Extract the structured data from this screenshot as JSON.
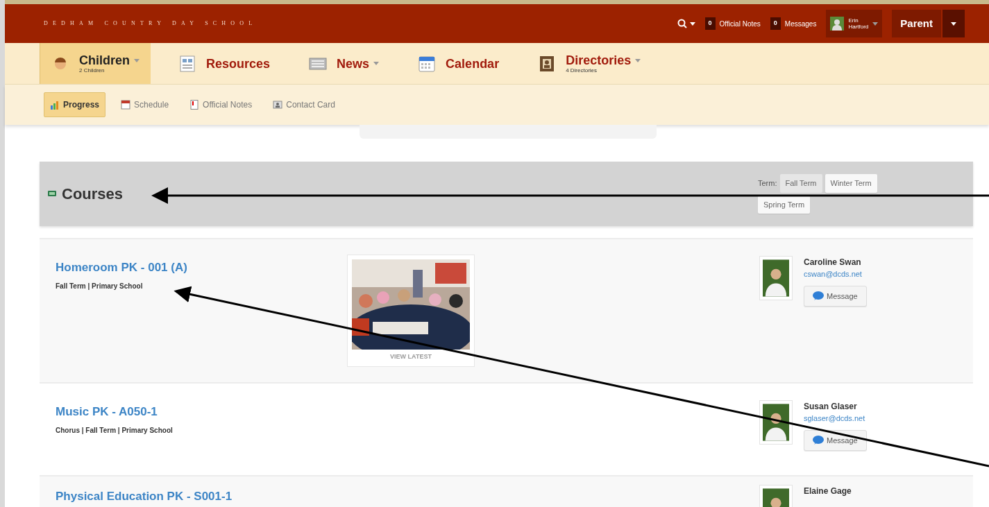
{
  "header": {
    "school_name": "DEDHAM COUNTRY DAY SCHOOL",
    "official_notes": {
      "count": "0",
      "label": "Official Notes"
    },
    "messages": {
      "count": "0",
      "label": "Messages"
    },
    "user": {
      "first": "Erin",
      "last": "Hartford"
    },
    "role": "Parent"
  },
  "nav": [
    {
      "label": "Children",
      "sub": "2 Children",
      "selected": true,
      "dropdown": true
    },
    {
      "label": "Resources",
      "selected": false,
      "dropdown": false
    },
    {
      "label": "News",
      "selected": false,
      "dropdown": true
    },
    {
      "label": "Calendar",
      "selected": false,
      "dropdown": false
    },
    {
      "label": "Directories",
      "sub": "4 Directories",
      "selected": false,
      "dropdown": true
    }
  ],
  "subnav": [
    {
      "label": "Progress",
      "selected": true
    },
    {
      "label": "Schedule",
      "selected": false
    },
    {
      "label": "Official Notes",
      "selected": false
    },
    {
      "label": "Contact Card",
      "selected": false
    }
  ],
  "courses": {
    "title": "Courses",
    "term_label": "Term:",
    "terms": [
      {
        "label": "Fall Term",
        "selected": true
      },
      {
        "label": "Winter Term",
        "selected": false
      },
      {
        "label": "Spring Term",
        "selected": false
      }
    ],
    "rows": [
      {
        "title": "Homeroom PK - 001 (A)",
        "meta": "Fall Term | Primary School",
        "photo": {
          "kind": "picture",
          "caption": "VIEW LATEST"
        },
        "teacher": {
          "name": "Caroline Swan",
          "email": "cswan@dcds.net",
          "button": "Message"
        }
      },
      {
        "title": "Music PK - A050-1",
        "meta": "Chorus | Fall Term | Primary School",
        "teacher": {
          "name": "Susan Glaser",
          "email": "sglaser@dcds.net",
          "button": "Message"
        }
      },
      {
        "title": "Physical Education PK - S001-1",
        "teacher": {
          "name": "Elaine Gage"
        }
      }
    ]
  }
}
